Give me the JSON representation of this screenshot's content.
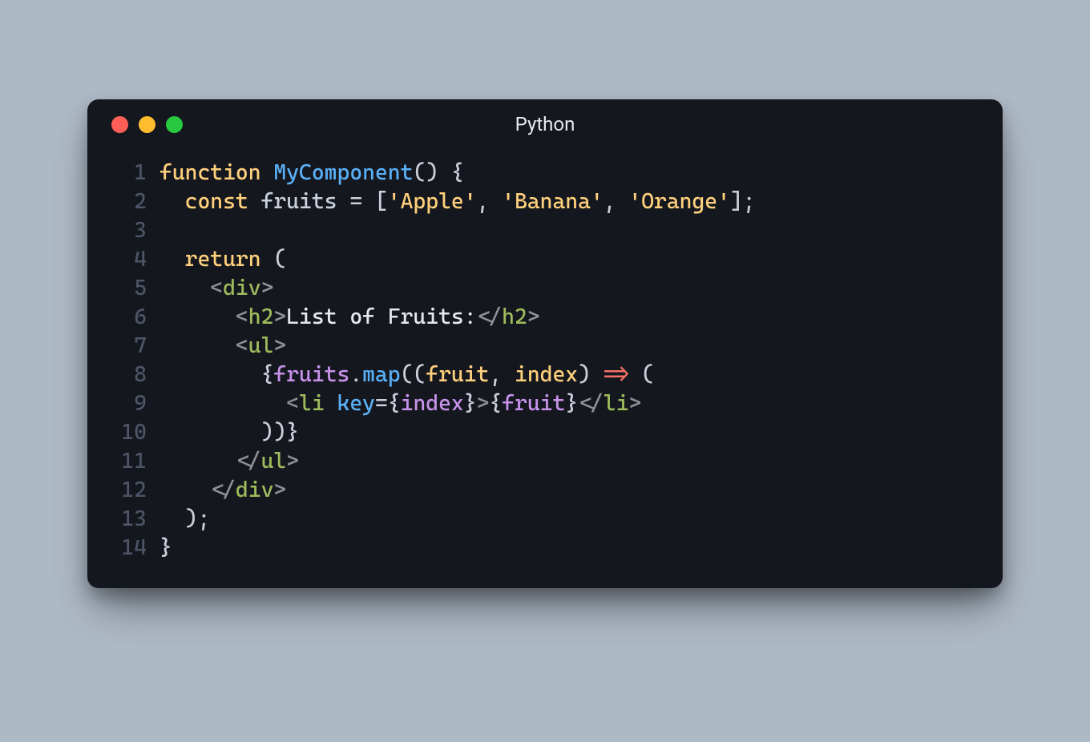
{
  "window": {
    "title": "Python",
    "traffic_lights": [
      "red",
      "yellow",
      "green"
    ]
  },
  "code": {
    "lines": [
      {
        "n": "1",
        "tokens": [
          [
            "kw",
            "function"
          ],
          [
            "",
            null,
            " "
          ],
          [
            "fn",
            "MyComponent"
          ],
          [
            "punc",
            "() {"
          ]
        ]
      },
      {
        "n": "2",
        "tokens": [
          [
            "",
            null,
            "  "
          ],
          [
            "kw",
            "const"
          ],
          [
            "",
            null,
            " "
          ],
          [
            "punc",
            "fruits = ["
          ],
          [
            "str",
            "'Apple'"
          ],
          [
            "punc",
            ", "
          ],
          [
            "str",
            "'Banana'"
          ],
          [
            "punc",
            ", "
          ],
          [
            "str",
            "'Orange'"
          ],
          [
            "punc",
            "];"
          ]
        ]
      },
      {
        "n": "3",
        "tokens": []
      },
      {
        "n": "4",
        "tokens": [
          [
            "",
            null,
            "  "
          ],
          [
            "kw",
            "return"
          ],
          [
            "punc",
            " ("
          ]
        ]
      },
      {
        "n": "5",
        "tokens": [
          [
            "",
            null,
            "    "
          ],
          [
            "tag-br",
            "<"
          ],
          [
            "tag-nm",
            "div"
          ],
          [
            "tag-br",
            ">"
          ]
        ]
      },
      {
        "n": "6",
        "tokens": [
          [
            "",
            null,
            "      "
          ],
          [
            "tag-br",
            "<"
          ],
          [
            "tag-nm",
            "h2"
          ],
          [
            "tag-br",
            ">"
          ],
          [
            "txt",
            "List of Fruits:"
          ],
          [
            "tag-br",
            "</"
          ],
          [
            "tag-nm",
            "h2"
          ],
          [
            "tag-br",
            ">"
          ]
        ]
      },
      {
        "n": "7",
        "tokens": [
          [
            "",
            null,
            "      "
          ],
          [
            "tag-br",
            "<"
          ],
          [
            "tag-nm",
            "ul"
          ],
          [
            "tag-br",
            ">"
          ]
        ]
      },
      {
        "n": "8",
        "tokens": [
          [
            "",
            null,
            "        "
          ],
          [
            "jsx-br",
            "{"
          ],
          [
            "var",
            "fruits"
          ],
          [
            "punc",
            "."
          ],
          [
            "fn",
            "map"
          ],
          [
            "punc",
            "(("
          ],
          [
            "param",
            "fruit"
          ],
          [
            "punc",
            ", "
          ],
          [
            "param",
            "index"
          ],
          [
            "punc",
            ") "
          ],
          [
            "arrow",
            "=>"
          ],
          [
            "punc",
            " ("
          ]
        ]
      },
      {
        "n": "9",
        "tokens": [
          [
            "",
            null,
            "          "
          ],
          [
            "tag-br",
            "<"
          ],
          [
            "tag-nm",
            "li"
          ],
          [
            "",
            null,
            " "
          ],
          [
            "fn",
            "key"
          ],
          [
            "punc",
            "="
          ],
          [
            "jsx-br",
            "{"
          ],
          [
            "var",
            "index"
          ],
          [
            "jsx-br",
            "}"
          ],
          [
            "tag-br",
            ">"
          ],
          [
            "jsx-br",
            "{"
          ],
          [
            "var",
            "fruit"
          ],
          [
            "jsx-br",
            "}"
          ],
          [
            "tag-br",
            "</"
          ],
          [
            "tag-nm",
            "li"
          ],
          [
            "tag-br",
            ">"
          ]
        ]
      },
      {
        "n": "10",
        "tokens": [
          [
            "",
            null,
            "        "
          ],
          [
            "punc",
            "))"
          ],
          [
            "jsx-br",
            "}"
          ]
        ]
      },
      {
        "n": "11",
        "tokens": [
          [
            "",
            null,
            "      "
          ],
          [
            "tag-br",
            "</"
          ],
          [
            "tag-nm",
            "ul"
          ],
          [
            "tag-br",
            ">"
          ]
        ]
      },
      {
        "n": "12",
        "tokens": [
          [
            "",
            null,
            "    "
          ],
          [
            "tag-br",
            "</"
          ],
          [
            "tag-nm",
            "div"
          ],
          [
            "tag-br",
            ">"
          ]
        ]
      },
      {
        "n": "13",
        "tokens": [
          [
            "",
            null,
            "  "
          ],
          [
            "punc",
            ");"
          ]
        ]
      },
      {
        "n": "14",
        "tokens": [
          [
            "punc",
            "}"
          ]
        ]
      }
    ]
  }
}
